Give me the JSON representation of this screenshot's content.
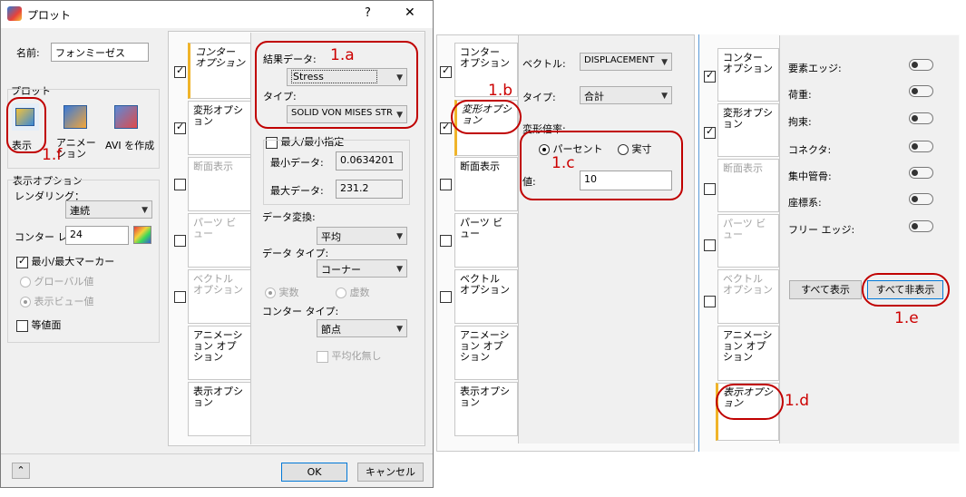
{
  "dialog": {
    "title": "プロット",
    "help": "?",
    "close": "✕",
    "name_label": "名前:",
    "name_value": "フォンミーゼス",
    "plot_group": "プロット",
    "plot_buttons": [
      "表示",
      "アニメーション",
      "AVI を作成"
    ],
    "display_options_group": "表示オプション",
    "rendering_label": "レンダリング：",
    "rendering_value": "連続",
    "contour_label": "コンター レ",
    "contour_value": "24",
    "minmax_marker": "最小/最大マーカー",
    "global_value": "グローバル値",
    "view_value": "表示ビュー値",
    "isosurface": "等値面",
    "ok": "OK",
    "cancel": "キャンセル",
    "collapse": "⌃"
  },
  "tabs": [
    "コンター オプション",
    "変形オプション",
    "断面表示",
    "パーツ ビュー",
    "ベクトル オプション",
    "アニメーション オプション",
    "表示オプション"
  ],
  "contour_panel": {
    "result_label": "結果データ:",
    "result_value": "Stress",
    "type_label": "タイプ:",
    "type_value": "SOLID VON MISES STR",
    "minmax_label": "最大/最小指定",
    "min_label": "最小データ:",
    "min_value": "0.0634201",
    "max_label": "最大データ:",
    "max_value": "231.2",
    "data_conv_label": "データ変換:",
    "data_conv_value": "平均",
    "data_type_label": "データ タイプ:",
    "data_type_value": "コーナー",
    "real": "実数",
    "imag": "虚数",
    "contour_type_label": "コンター タイプ:",
    "contour_type_value": "節点",
    "no_average": "平均化無し"
  },
  "deform_panel": {
    "vector_label": "ベクトル:",
    "vector_value": "DISPLACEMENT",
    "type_label": "タイプ:",
    "type_value": "合計",
    "scale_label": "変形倍率:",
    "percent": "パーセント",
    "actual": "実寸",
    "value_label": "値:",
    "value": "10"
  },
  "display_panel": {
    "items": [
      "要素エッジ:",
      "荷重:",
      "拘束:",
      "コネクタ:",
      "集中管骨:",
      "座標系:",
      "フリー エッジ:"
    ],
    "show_all": "すべて表示",
    "hide_all": "すべて非表示"
  },
  "annotations": [
    "1.a",
    "1.b",
    "1.c",
    "1.d",
    "1.e",
    "1.f"
  ],
  "colors": {
    "annotation": "#c00000",
    "tab_accent": "#f0b429",
    "ok_border": "#0078d7"
  }
}
